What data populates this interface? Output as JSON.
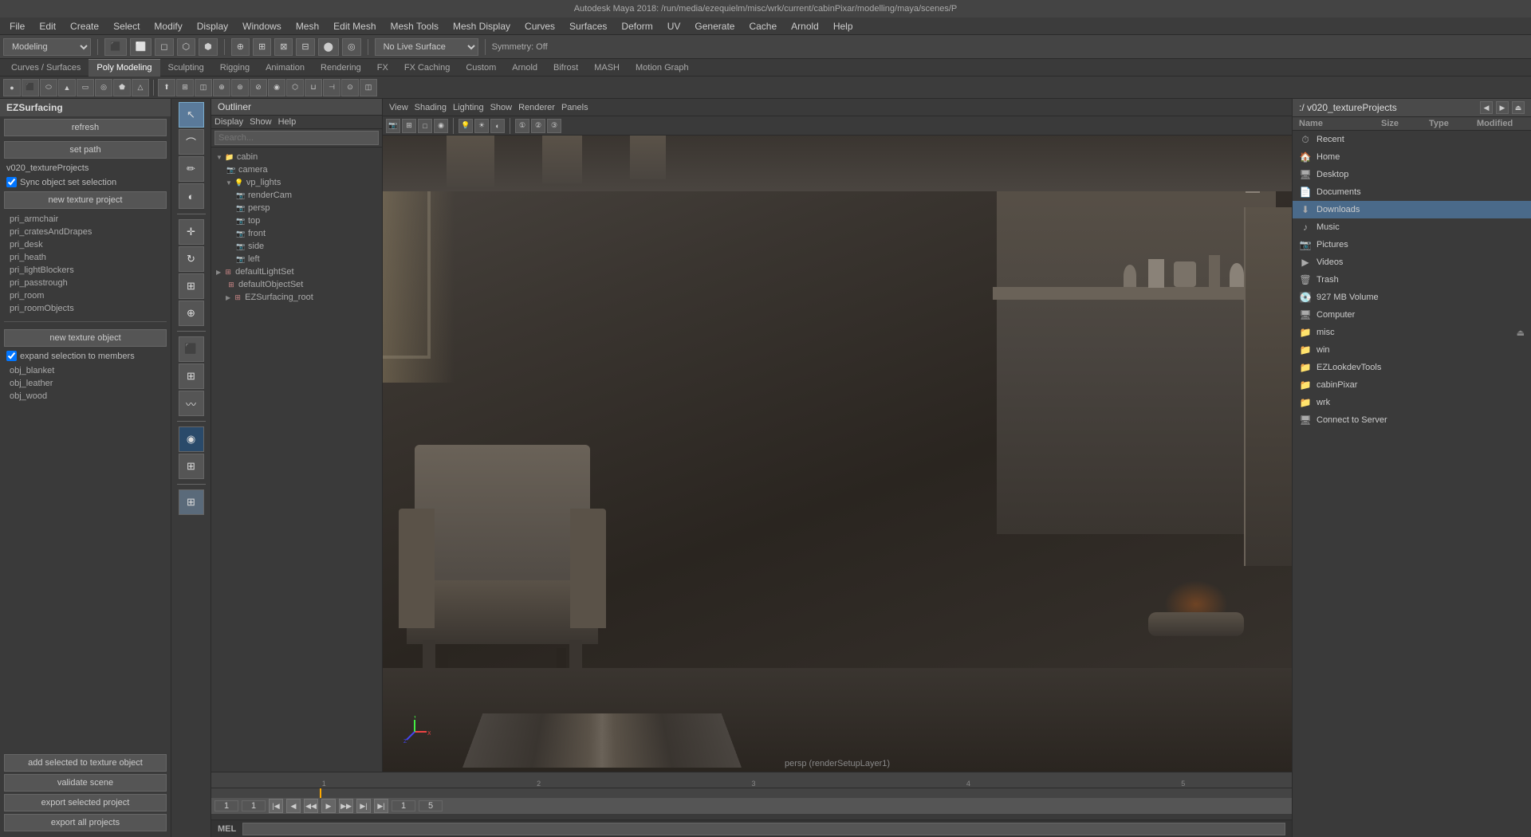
{
  "titlebar": {
    "text": "Autodesk Maya 2018: /run/media/ezequielm/misc/wrk/current/cabinPixar/modelling/maya/scenes/P"
  },
  "menubar": {
    "items": [
      "File",
      "Edit",
      "Create",
      "Select",
      "Modify",
      "Display",
      "Windows",
      "Mesh",
      "Edit Mesh",
      "Mesh Tools",
      "Mesh Display",
      "Curves",
      "Surfaces",
      "Deform",
      "UV",
      "Generate",
      "Cache",
      "Arnold",
      "Help"
    ]
  },
  "toolbar": {
    "mode_label": "Modeling",
    "symmetry_label": "Symmetry: Off"
  },
  "tabs": {
    "items": [
      "Curves / Surfaces",
      "Poly Modeling",
      "Sculpting",
      "Rigging",
      "Animation",
      "Rendering",
      "FX",
      "FX Caching",
      "Custom",
      "Arnold",
      "Bifrost",
      "MASH",
      "Motion Graph"
    ]
  },
  "left_panel": {
    "header": "EZSurfacing",
    "refresh_btn": "refresh",
    "set_path_btn": "set path",
    "project_label": "v020_textureProjects",
    "sync_checkbox": "Sync object set selection",
    "new_project_btn": "new texture project",
    "projects": [
      "pri_armchair",
      "pri_cratesAndDrapes",
      "pri_desk",
      "pri_heath",
      "pri_lightBlockers",
      "pri_passtrough",
      "pri_room",
      "pri_roomObjects"
    ],
    "new_object_btn": "new texture object",
    "expand_checkbox": "expand selection to members",
    "objects": [
      "obj_blanket",
      "obj_leather",
      "obj_wood"
    ],
    "add_selected_btn": "add selected to texture object",
    "validate_btn": "validate scene",
    "export_selected_btn": "export selected project",
    "export_all_btn": "export all projects"
  },
  "outliner": {
    "header": "Outliner",
    "menu_items": [
      "Display",
      "Show",
      "Help"
    ],
    "search_placeholder": "Search...",
    "tree": [
      {
        "label": "cabin",
        "icon": "folder",
        "level": 0,
        "expanded": true
      },
      {
        "label": "camera",
        "icon": "camera",
        "level": 1
      },
      {
        "label": "vp_lights",
        "icon": "folder",
        "level": 1,
        "expanded": true
      },
      {
        "label": "renderCam",
        "icon": "camera",
        "level": 2
      },
      {
        "label": "persp",
        "icon": "camera",
        "level": 2
      },
      {
        "label": "top",
        "icon": "camera",
        "level": 2
      },
      {
        "label": "front",
        "icon": "camera",
        "level": 2
      },
      {
        "label": "side",
        "icon": "camera",
        "level": 2
      },
      {
        "label": "left",
        "icon": "camera",
        "level": 2
      },
      {
        "label": "defaultLightSet",
        "icon": "light",
        "level": 0
      },
      {
        "label": "defaultObjectSet",
        "icon": "mesh",
        "level": 1
      },
      {
        "label": "EZSurfacing_root",
        "icon": "node",
        "level": 1
      }
    ]
  },
  "viewport": {
    "menu_items": [
      "View",
      "Shading",
      "Lighting",
      "Show",
      "Renderer",
      "Panels"
    ],
    "label": "persp (renderSetupLayer1)"
  },
  "right_panel": {
    "path": ":/ v020_textureProjects",
    "columns": {
      "name": "Name",
      "size": "Size",
      "type": "Type",
      "modified": "Modified"
    },
    "items": [
      {
        "icon": "⏱",
        "name": "Recent",
        "type": "place"
      },
      {
        "icon": "🏠",
        "name": "Home",
        "type": "place"
      },
      {
        "icon": "🖥",
        "name": "Desktop",
        "type": "place"
      },
      {
        "icon": "📄",
        "name": "Documents",
        "type": "place"
      },
      {
        "icon": "⬇",
        "name": "Downloads",
        "type": "place",
        "selected": true
      },
      {
        "icon": "♪",
        "name": "Music",
        "type": "place"
      },
      {
        "icon": "📷",
        "name": "Pictures",
        "type": "place"
      },
      {
        "icon": "▶",
        "name": "Videos",
        "type": "place"
      },
      {
        "icon": "🗑",
        "name": "Trash",
        "type": "place"
      },
      {
        "icon": "💽",
        "name": "927 MB Volume",
        "type": "drive"
      },
      {
        "icon": "🖥",
        "name": "Computer",
        "type": "place"
      },
      {
        "icon": "📁",
        "name": "misc",
        "type": "folder"
      },
      {
        "icon": "📁",
        "name": "win",
        "type": "folder"
      },
      {
        "icon": "📁",
        "name": "EZLookdevTools",
        "type": "folder"
      },
      {
        "icon": "📁",
        "name": "cabinPixar",
        "type": "folder"
      },
      {
        "icon": "📁",
        "name": "wrk",
        "type": "folder"
      },
      {
        "icon": "🖥",
        "name": "Connect to Server",
        "type": "server"
      }
    ]
  },
  "timeline": {
    "markers": [
      "1",
      "2",
      "3",
      "4",
      "5"
    ],
    "current_frame": "1",
    "start_frame": "1",
    "end_frame": "5"
  },
  "statusbar": {
    "mel_label": "MEL"
  }
}
